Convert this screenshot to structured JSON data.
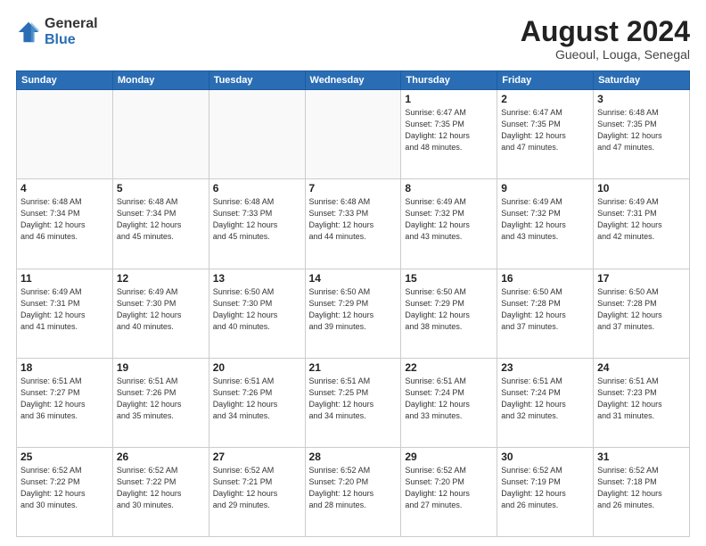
{
  "logo": {
    "general": "General",
    "blue": "Blue"
  },
  "header": {
    "month_year": "August 2024",
    "location": "Gueoul, Louga, Senegal"
  },
  "days_of_week": [
    "Sunday",
    "Monday",
    "Tuesday",
    "Wednesday",
    "Thursday",
    "Friday",
    "Saturday"
  ],
  "weeks": [
    [
      {
        "day": "",
        "info": ""
      },
      {
        "day": "",
        "info": ""
      },
      {
        "day": "",
        "info": ""
      },
      {
        "day": "",
        "info": ""
      },
      {
        "day": "1",
        "info": "Sunrise: 6:47 AM\nSunset: 7:35 PM\nDaylight: 12 hours\nand 48 minutes."
      },
      {
        "day": "2",
        "info": "Sunrise: 6:47 AM\nSunset: 7:35 PM\nDaylight: 12 hours\nand 47 minutes."
      },
      {
        "day": "3",
        "info": "Sunrise: 6:48 AM\nSunset: 7:35 PM\nDaylight: 12 hours\nand 47 minutes."
      }
    ],
    [
      {
        "day": "4",
        "info": "Sunrise: 6:48 AM\nSunset: 7:34 PM\nDaylight: 12 hours\nand 46 minutes."
      },
      {
        "day": "5",
        "info": "Sunrise: 6:48 AM\nSunset: 7:34 PM\nDaylight: 12 hours\nand 45 minutes."
      },
      {
        "day": "6",
        "info": "Sunrise: 6:48 AM\nSunset: 7:33 PM\nDaylight: 12 hours\nand 45 minutes."
      },
      {
        "day": "7",
        "info": "Sunrise: 6:48 AM\nSunset: 7:33 PM\nDaylight: 12 hours\nand 44 minutes."
      },
      {
        "day": "8",
        "info": "Sunrise: 6:49 AM\nSunset: 7:32 PM\nDaylight: 12 hours\nand 43 minutes."
      },
      {
        "day": "9",
        "info": "Sunrise: 6:49 AM\nSunset: 7:32 PM\nDaylight: 12 hours\nand 43 minutes."
      },
      {
        "day": "10",
        "info": "Sunrise: 6:49 AM\nSunset: 7:31 PM\nDaylight: 12 hours\nand 42 minutes."
      }
    ],
    [
      {
        "day": "11",
        "info": "Sunrise: 6:49 AM\nSunset: 7:31 PM\nDaylight: 12 hours\nand 41 minutes."
      },
      {
        "day": "12",
        "info": "Sunrise: 6:49 AM\nSunset: 7:30 PM\nDaylight: 12 hours\nand 40 minutes."
      },
      {
        "day": "13",
        "info": "Sunrise: 6:50 AM\nSunset: 7:30 PM\nDaylight: 12 hours\nand 40 minutes."
      },
      {
        "day": "14",
        "info": "Sunrise: 6:50 AM\nSunset: 7:29 PM\nDaylight: 12 hours\nand 39 minutes."
      },
      {
        "day": "15",
        "info": "Sunrise: 6:50 AM\nSunset: 7:29 PM\nDaylight: 12 hours\nand 38 minutes."
      },
      {
        "day": "16",
        "info": "Sunrise: 6:50 AM\nSunset: 7:28 PM\nDaylight: 12 hours\nand 37 minutes."
      },
      {
        "day": "17",
        "info": "Sunrise: 6:50 AM\nSunset: 7:28 PM\nDaylight: 12 hours\nand 37 minutes."
      }
    ],
    [
      {
        "day": "18",
        "info": "Sunrise: 6:51 AM\nSunset: 7:27 PM\nDaylight: 12 hours\nand 36 minutes."
      },
      {
        "day": "19",
        "info": "Sunrise: 6:51 AM\nSunset: 7:26 PM\nDaylight: 12 hours\nand 35 minutes."
      },
      {
        "day": "20",
        "info": "Sunrise: 6:51 AM\nSunset: 7:26 PM\nDaylight: 12 hours\nand 34 minutes."
      },
      {
        "day": "21",
        "info": "Sunrise: 6:51 AM\nSunset: 7:25 PM\nDaylight: 12 hours\nand 34 minutes."
      },
      {
        "day": "22",
        "info": "Sunrise: 6:51 AM\nSunset: 7:24 PM\nDaylight: 12 hours\nand 33 minutes."
      },
      {
        "day": "23",
        "info": "Sunrise: 6:51 AM\nSunset: 7:24 PM\nDaylight: 12 hours\nand 32 minutes."
      },
      {
        "day": "24",
        "info": "Sunrise: 6:51 AM\nSunset: 7:23 PM\nDaylight: 12 hours\nand 31 minutes."
      }
    ],
    [
      {
        "day": "25",
        "info": "Sunrise: 6:52 AM\nSunset: 7:22 PM\nDaylight: 12 hours\nand 30 minutes."
      },
      {
        "day": "26",
        "info": "Sunrise: 6:52 AM\nSunset: 7:22 PM\nDaylight: 12 hours\nand 30 minutes."
      },
      {
        "day": "27",
        "info": "Sunrise: 6:52 AM\nSunset: 7:21 PM\nDaylight: 12 hours\nand 29 minutes."
      },
      {
        "day": "28",
        "info": "Sunrise: 6:52 AM\nSunset: 7:20 PM\nDaylight: 12 hours\nand 28 minutes."
      },
      {
        "day": "29",
        "info": "Sunrise: 6:52 AM\nSunset: 7:20 PM\nDaylight: 12 hours\nand 27 minutes."
      },
      {
        "day": "30",
        "info": "Sunrise: 6:52 AM\nSunset: 7:19 PM\nDaylight: 12 hours\nand 26 minutes."
      },
      {
        "day": "31",
        "info": "Sunrise: 6:52 AM\nSunset: 7:18 PM\nDaylight: 12 hours\nand 26 minutes."
      }
    ]
  ]
}
